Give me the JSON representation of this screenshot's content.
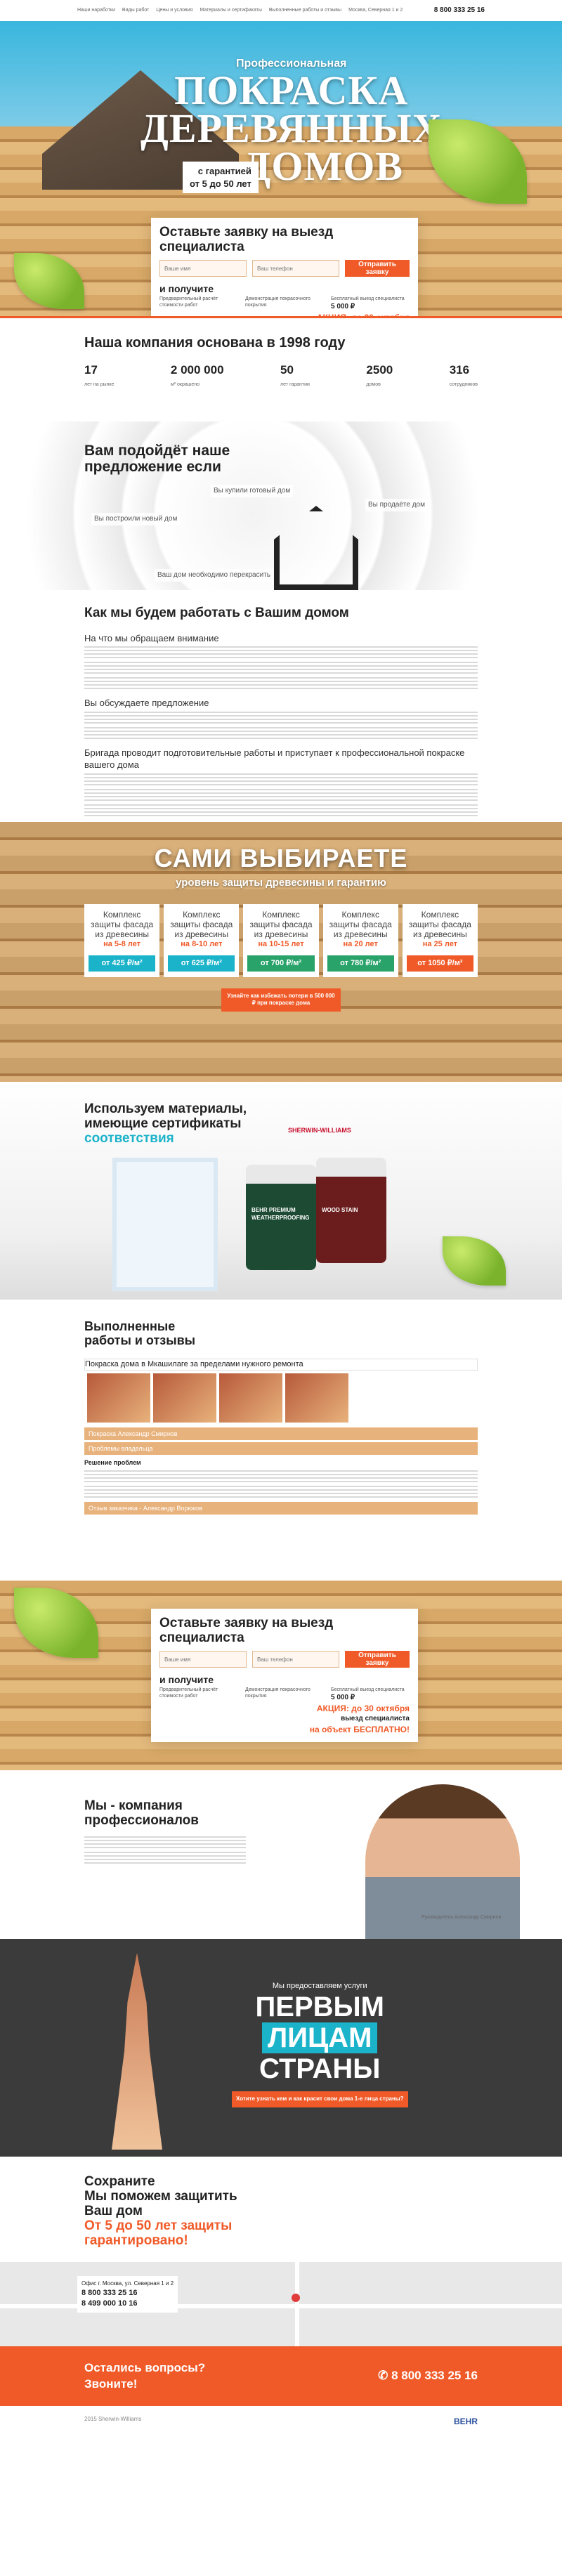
{
  "nav": {
    "items": [
      "Наши наработки",
      "Виды работ",
      "Цены и условия",
      "Материалы и сертификаты",
      "Выполненные работы и отзывы"
    ],
    "address": "Москва, Северная 1 и 2",
    "phone": "8 800 333 25 16"
  },
  "hero": {
    "pretitle": "Профессиональная",
    "title1": "ПОКРАСКА",
    "title2": "ДЕРЕВЯННЫХ",
    "title3": "ДОМОВ",
    "guar1": "с гарантией",
    "guar2": "от 5 до 50 лет"
  },
  "request": {
    "title1": "Оставьте заявку на выезд",
    "title2": "специалиста",
    "name_ph": "Ваше имя",
    "phone_ph": "Ваш телефон",
    "button": "Отправить заявку",
    "get": "и получите",
    "b1": "Предварительный расчёт стоимости работ",
    "b2": "Демонстрация покрасочного покрытия",
    "b3": "Бесплатный выезд специалиста",
    "price": "5 000 ₽",
    "promo1": "АКЦИЯ: до 30 октября",
    "promo2": "выезд специалиста",
    "promo3": "на объект БЕСПЛАТНО!"
  },
  "founded": {
    "title": "Наша компания основана в 1998 году",
    "stats": [
      {
        "v": "17",
        "l": "лет на рынке"
      },
      {
        "v": "2 000 000",
        "l": "м² окрашено"
      },
      {
        "v": "50",
        "l": "лет гарантии"
      },
      {
        "v": "2500",
        "l": "домов"
      },
      {
        "v": "316",
        "l": "сотрудников"
      }
    ]
  },
  "suits": {
    "title": "Вам подойдёт наше предложение если",
    "o1": "Вы построили новый дом",
    "o2": "Вы купили готовый дом",
    "o3": "Вы продаёте дом",
    "o4": "Ваш дом необходимо перекрасить"
  },
  "work": {
    "title": "Как мы будем работать с Вашим домом",
    "s1": "На что мы обращаем внимание",
    "s2": "Вы обсуждаете предложение",
    "s3": "Бригада проводит подготовительные работы и приступает к профессиональной покраске вашего дома"
  },
  "choose": {
    "t1": "Вы",
    "t2": "САМИ ВЫБИРАЕТЕ",
    "t3": "уровень защиты древесины и гарантию",
    "packs": [
      {
        "h": "Комплекс защиты фасада из древесины",
        "y": "на 5-8 лет",
        "p": "от 425 ₽/м²",
        "c": "#1bb3c9"
      },
      {
        "h": "Комплекс защиты фасада из древесины",
        "y": "на 8-10 лет",
        "p": "от 625 ₽/м²",
        "c": "#1bb3c9"
      },
      {
        "h": "Комплекс защиты фасада из древесины",
        "y": "на 10-15 лет",
        "p": "от 700 ₽/м²",
        "c": "#2aa36b"
      },
      {
        "h": "Комплекс защиты фасада из древесины",
        "y": "на 20 лет",
        "p": "от 780 ₽/м²",
        "c": "#2aa36b"
      },
      {
        "h": "Комплекс защиты фасада из древесины",
        "y": "на 25 лет",
        "p": "от 1050 ₽/м²",
        "c": "#f05a28"
      }
    ],
    "cta": "Узнайте как избежать потери в 500 000 ₽ при покраске дома"
  },
  "certs": {
    "title1": "Используем материалы,",
    "title2": "имеющие сертификаты",
    "title3": "соответствия",
    "brand": "SHERWIN-WILLIAMS",
    "can1": "BEHR PREMIUM WEATHERPROOFING",
    "can2": "WOOD STAIN"
  },
  "works": {
    "title1": "Выполненные",
    "title2": "работы и отзывы",
    "bar": "Покраска дома в Мкашилаге за пределами нужного ремонта",
    "a1": "Покраска Александр Смирнов",
    "a2": "Проблемы владельца",
    "a3": "Решение проблем",
    "a4": "Отзыв заказчика - Александр Ворюков"
  },
  "pros": {
    "title1": "Мы - компания",
    "title2": "профессионалов",
    "sign": "Руководитель Александр Смирнов"
  },
  "first": {
    "pre": "Мы предоставляем услуги",
    "l1": "ПЕРВЫМ",
    "l2": "ЛИЦАМ",
    "l3": "СТРАНЫ",
    "cta": "Хотите узнать кем и как красит свои дома 1-е лица страны?"
  },
  "save": {
    "t1": "Сохраните",
    "t2": "Мы поможем защитить",
    "t3": "Ваш дом",
    "t4": "От 5 до 50 лет защиты",
    "t5": "гарантировано!"
  },
  "map": {
    "addr": "Офис г. Москва, ул. Северная 1 и 2",
    "p1": "8 800 333 25 16",
    "p2": "8 499 000 10 16"
  },
  "contact": {
    "q1": "Остались вопросы?",
    "q2": "Звоните!",
    "phone": "8 800 333 25 16"
  },
  "footer": {
    "copy": "2015 Sherwin-Williams",
    "logo": "BEHR"
  }
}
